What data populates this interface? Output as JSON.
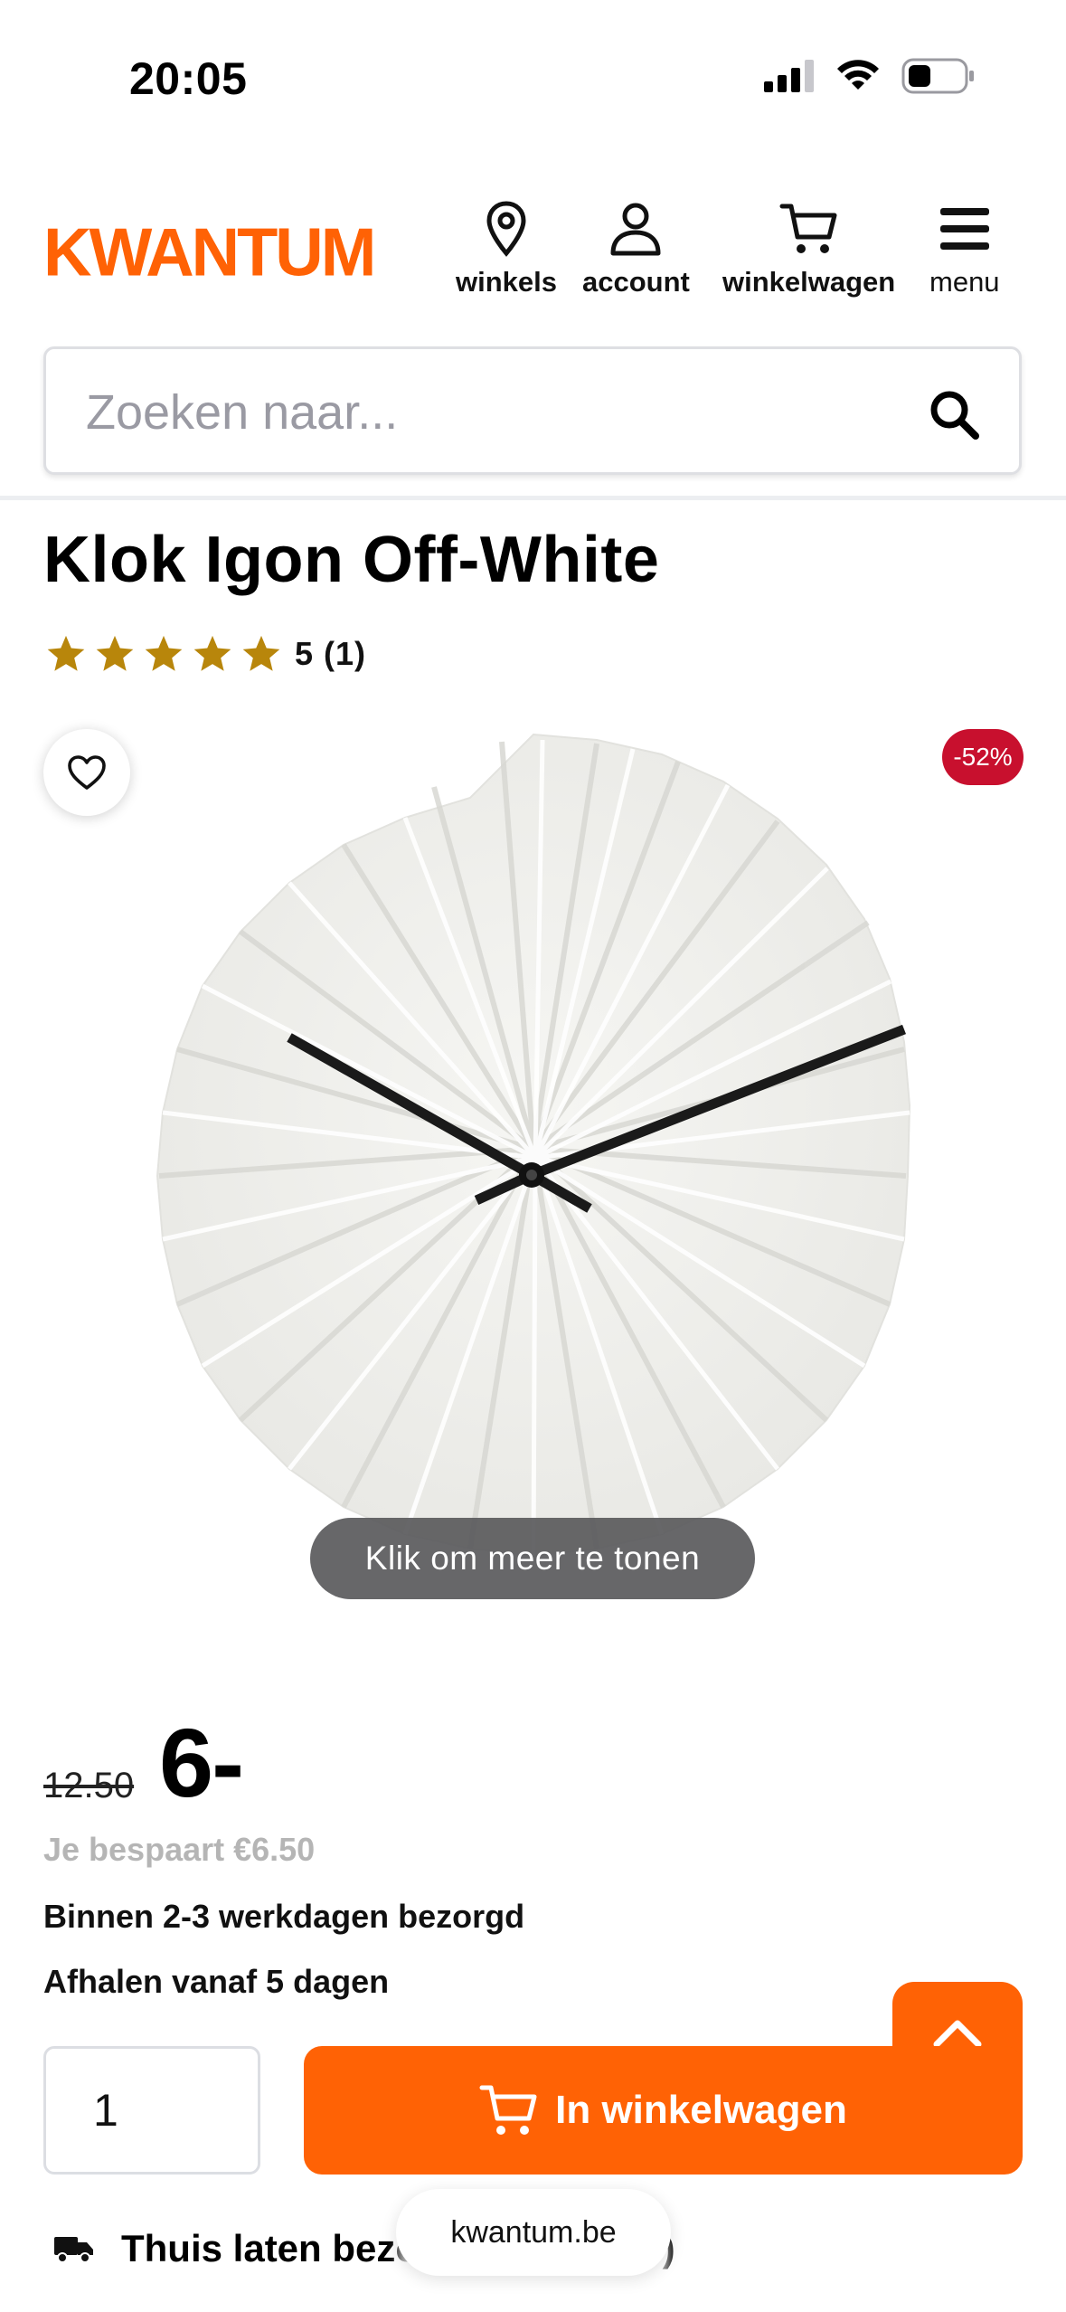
{
  "status_bar": {
    "time": "20:05"
  },
  "header": {
    "logo": "KWANTUM",
    "nav": {
      "stores": "winkels",
      "account": "account",
      "cart": "winkelwagen",
      "menu": "menu"
    }
  },
  "search": {
    "placeholder": "Zoeken naar..."
  },
  "product": {
    "title": "Klok Igon Off-White",
    "rating_text": "5 (1)",
    "rating_value": 5,
    "discount_badge": "-52%",
    "image_hint": "Klik om meer te tonen",
    "old_price": "12.50",
    "new_price": "6-",
    "savings": "Je bespaart €6.50",
    "delivery": "Binnen 2-3 werkdagen bezorgd",
    "pickup": "Afhalen vanaf 5 dagen",
    "quantity": "1",
    "add_to_cart": "In winkelwagen",
    "home_delivery": "Thuis laten bezorgen (+ € 5,99)"
  },
  "browser": {
    "url": "kwantum.be"
  },
  "colors": {
    "brand": "#ff6205",
    "discount": "#c8102e",
    "star": "#b8860b"
  }
}
